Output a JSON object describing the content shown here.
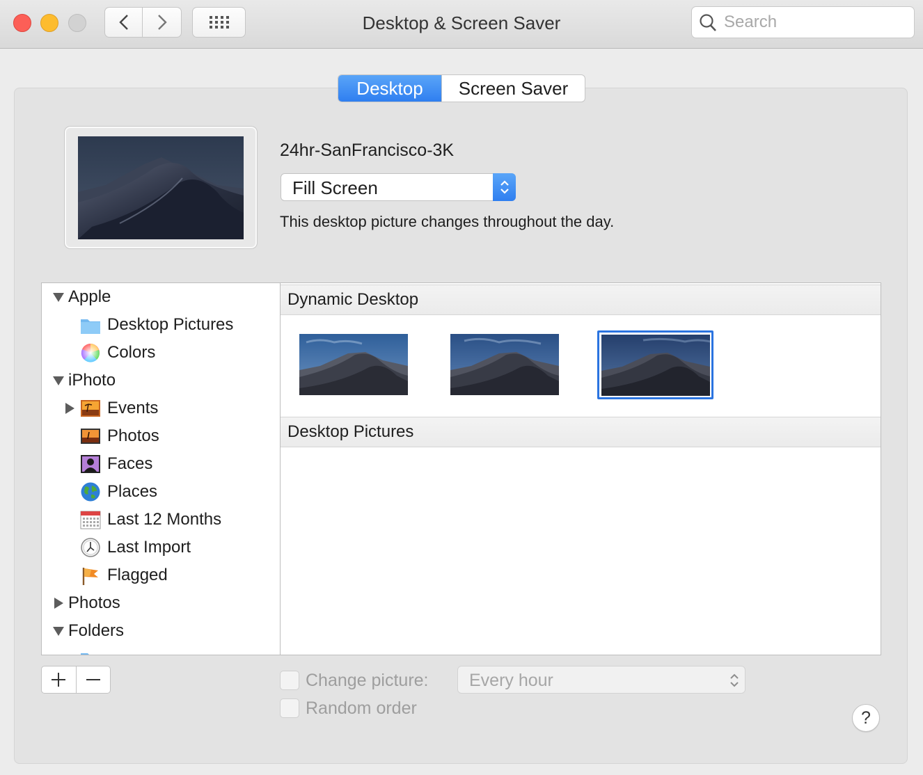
{
  "window": {
    "title": "Desktop & Screen Saver"
  },
  "toolbar": {
    "search_placeholder": "Search"
  },
  "tabs": [
    {
      "label": "Desktop",
      "selected": true
    },
    {
      "label": "Screen Saver",
      "selected": false
    }
  ],
  "current": {
    "picture_name": "24hr-SanFrancisco-3K",
    "fit_option": "Fill Screen",
    "description": "This desktop picture changes throughout the day."
  },
  "sources": [
    {
      "label": "Apple",
      "kind": "group",
      "expanded": true,
      "icon": ""
    },
    {
      "label": "Desktop Pictures",
      "kind": "item",
      "icon": "folder-icon"
    },
    {
      "label": "Colors",
      "kind": "item",
      "icon": "color-wheel-icon"
    },
    {
      "label": "iPhoto",
      "kind": "group",
      "expanded": true,
      "icon": ""
    },
    {
      "label": "Events",
      "kind": "item",
      "icon": "events-icon",
      "disclosure": "collapsed"
    },
    {
      "label": "Photos",
      "kind": "item",
      "icon": "photos-icon"
    },
    {
      "label": "Faces",
      "kind": "item",
      "icon": "faces-icon"
    },
    {
      "label": "Places",
      "kind": "item",
      "icon": "globe-icon"
    },
    {
      "label": "Last 12 Months",
      "kind": "item",
      "icon": "calendar-icon"
    },
    {
      "label": "Last Import",
      "kind": "item",
      "icon": "clock-icon"
    },
    {
      "label": "Flagged",
      "kind": "item",
      "icon": "flag-icon"
    },
    {
      "label": "Photos",
      "kind": "group",
      "expanded": false,
      "icon": ""
    },
    {
      "label": "Folders",
      "kind": "group",
      "expanded": true,
      "icon": ""
    }
  ],
  "browser": {
    "sections": [
      "Dynamic Desktop",
      "Desktop Pictures"
    ],
    "thumbnails": [
      {
        "name": "mojave-dynamic-thumbnail-1",
        "selected": false
      },
      {
        "name": "mojave-dynamic-thumbnail-2",
        "selected": false
      },
      {
        "name": "mojave-dynamic-thumbnail-3",
        "selected": true
      }
    ]
  },
  "controls": {
    "change_picture_label": "Change picture:",
    "change_picture_interval": "Every hour",
    "change_picture_checked": false,
    "random_order_label": "Random order",
    "random_order_checked": false,
    "add_symbol": "+",
    "remove_symbol": "−",
    "help_symbol": "?"
  },
  "colors": {
    "accent_blue": "#2f7ff0",
    "close_red": "#fc5f57",
    "minimize_yellow": "#fdbc2e",
    "zoom_gray": "#d2d2d2"
  }
}
